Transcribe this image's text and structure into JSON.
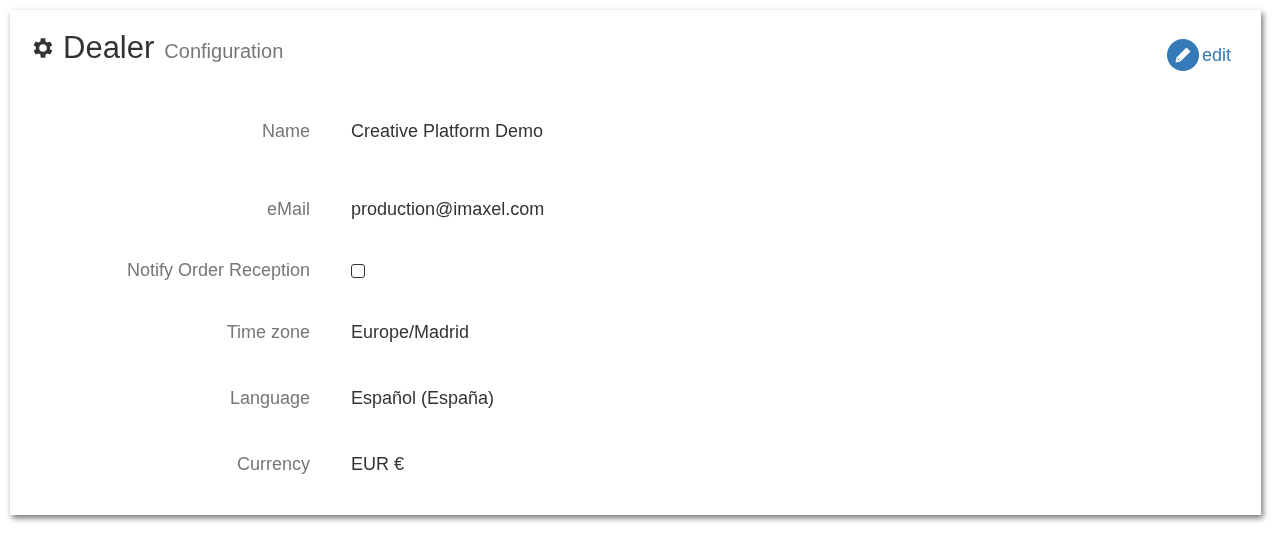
{
  "header": {
    "title": "Dealer",
    "subtitle": "Configuration",
    "action": "edit"
  },
  "fields": [
    {
      "kind": "text",
      "label": "Name",
      "value": "Creative Platform Demo"
    },
    {
      "kind": "text",
      "label": "eMail",
      "value": "production@imaxel.com"
    },
    {
      "kind": "checkbox",
      "label": "Notify Order Reception",
      "checked": false
    },
    {
      "kind": "text",
      "label": "Time zone",
      "value": "Europe/Madrid"
    },
    {
      "kind": "text",
      "label": "Language",
      "value": "Español (España)"
    },
    {
      "kind": "text",
      "label": "Currency",
      "value": "EUR €"
    }
  ]
}
